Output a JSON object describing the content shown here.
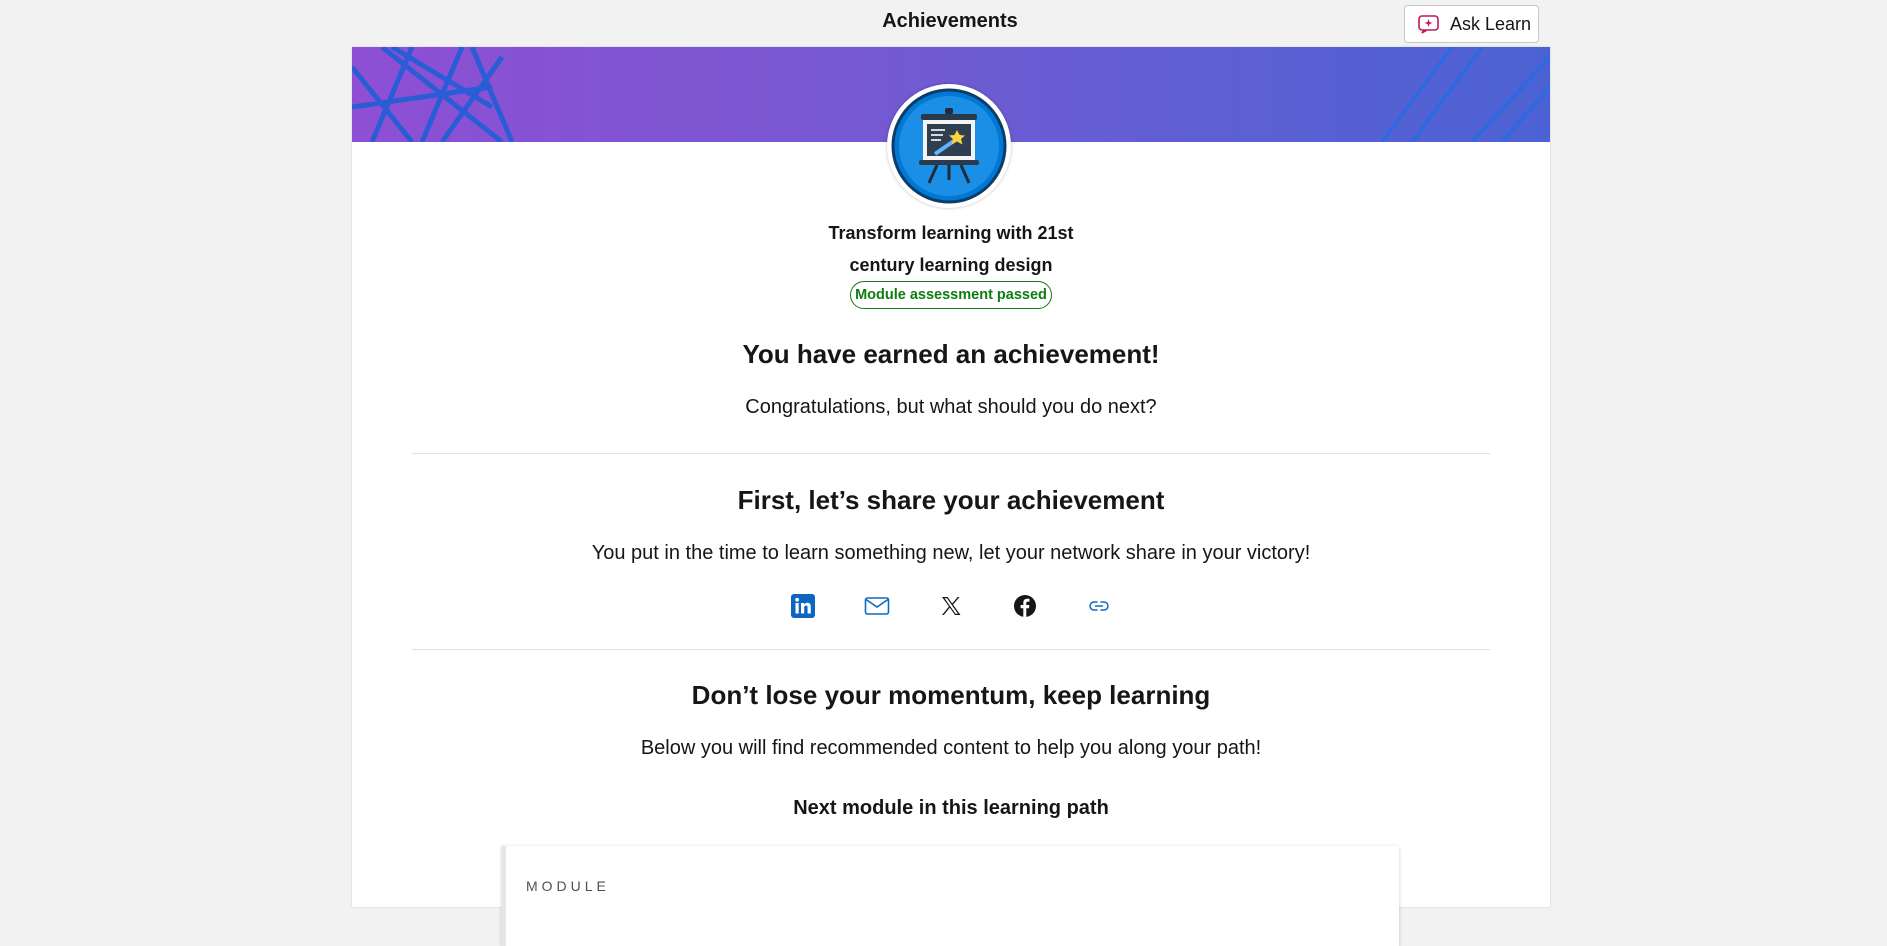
{
  "header": {
    "title": "Achievements",
    "ask_learn_label": "Ask Learn"
  },
  "achievement": {
    "module_title_line1": "Transform learning with 21st",
    "module_title_line2": "century learning design",
    "status": "Module assessment passed",
    "status_color": "#107c10"
  },
  "earned": {
    "heading": "You have earned an achievement!",
    "subtext": "Congratulations, but what should you do next?"
  },
  "share": {
    "heading": "First, let’s share your achievement",
    "subtext": "You put in the time to learn something new, let your network share in your victory!",
    "buttons": [
      {
        "icon": "linkedin-icon"
      },
      {
        "icon": "email-icon"
      },
      {
        "icon": "x-icon"
      },
      {
        "icon": "facebook-icon"
      },
      {
        "icon": "link-icon"
      }
    ]
  },
  "momentum": {
    "heading": "Don’t lose your momentum, keep learning",
    "subtext": "Below you will find recommended content to help you along your path!",
    "next_heading": "Next module in this learning path",
    "card_type": "MODULE"
  },
  "colors": {
    "linkedin": "#0a66c2",
    "accent": "#0f6cbd",
    "banner_start": "#8e4fd4",
    "banner_end": "#4c62d4"
  }
}
